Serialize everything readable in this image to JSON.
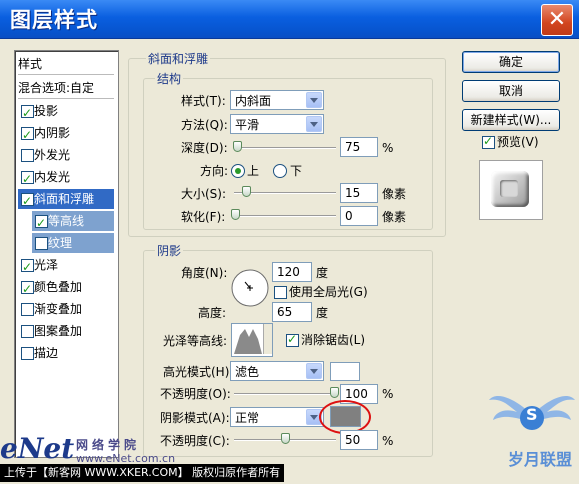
{
  "window": {
    "title": "图层样式",
    "close_glyph": "✕"
  },
  "styles_list": {
    "header": "样式",
    "blend_options": "混合选项:自定",
    "items": [
      {
        "label": "投影",
        "checked": true
      },
      {
        "label": "内阴影",
        "checked": true
      },
      {
        "label": "外发光",
        "checked": false
      },
      {
        "label": "内发光",
        "checked": true
      },
      {
        "label": "斜面和浮雕",
        "checked": true,
        "selected": true
      },
      {
        "label": "等高线",
        "checked": true,
        "sub": true
      },
      {
        "label": "纹理",
        "checked": false,
        "sub": true
      },
      {
        "label": "光泽",
        "checked": true
      },
      {
        "label": "颜色叠加",
        "checked": true
      },
      {
        "label": "渐变叠加",
        "checked": false
      },
      {
        "label": "图案叠加",
        "checked": false
      },
      {
        "label": "描边",
        "checked": false
      }
    ]
  },
  "bevel": {
    "section_title": "斜面和浮雕",
    "structure_title": "结构",
    "style_label": "样式(T):",
    "style_value": "内斜面",
    "technique_label": "方法(Q):",
    "technique_value": "平滑",
    "depth_label": "深度(D):",
    "depth_value": "75",
    "depth_unit": "%",
    "direction_label": "方向:",
    "dir_up": "上",
    "dir_down": "下",
    "size_label": "大小(S):",
    "size_value": "15",
    "size_unit": "像素",
    "soften_label": "软化(F):",
    "soften_value": "0",
    "soften_unit": "像素"
  },
  "shading": {
    "title": "阴影",
    "angle_label": "角度(N):",
    "angle_value": "120",
    "angle_unit": "度",
    "global_light_label": "使用全局光(G)",
    "altitude_label": "高度:",
    "altitude_value": "65",
    "altitude_unit": "度",
    "gloss_contour_label": "光泽等高线:",
    "antialias_label": "消除锯齿(L)",
    "highlight_mode_label": "高光模式(H):",
    "highlight_mode_value": "滤色",
    "highlight_opacity_label": "不透明度(O):",
    "highlight_opacity_value": "100",
    "shadow_mode_label": "阴影模式(A):",
    "shadow_mode_value": "正常",
    "shadow_opacity_label": "不透明度(C):",
    "shadow_opacity_value": "50",
    "percent": "%",
    "highlight_color": "#ffffff",
    "shadow_color": "#808080"
  },
  "buttons": {
    "ok": "确定",
    "cancel": "取消",
    "new_style": "新建样式(W)...",
    "preview": "预览(V)"
  },
  "watermark": {
    "enet": "eNet",
    "school": "网络学院",
    "domain": "www.eNet.com.cn",
    "footer": "上传于【新客网 WWW.XKER.COM】 版权归原作者所有",
    "brand": "岁月联盟",
    "brand_sub": "S"
  }
}
